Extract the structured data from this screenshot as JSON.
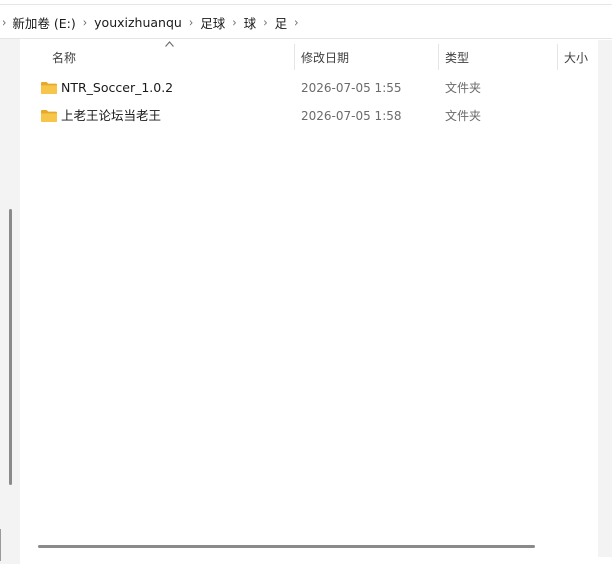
{
  "address_bar": {
    "crumbs": [
      "新加卷 (E:)",
      "youxizhuanqu",
      "足球",
      "球",
      "足"
    ]
  },
  "columns": {
    "name": "名称",
    "date_modified": "修改日期",
    "type": "类型",
    "size": "大小"
  },
  "files": [
    {
      "name": "NTR_Soccer_1.0.2",
      "date": "2026-07-05 1:55",
      "type": "文件夹",
      "icon": "folder-icon"
    },
    {
      "name": "上老王论坛当老王",
      "date": "2026-07-05 1:58",
      "type": "文件夹",
      "icon": "folder-icon"
    }
  ],
  "colors": {
    "folder": "#F8C54B",
    "folder_dark": "#E6A92A",
    "nav_bg": "#F3F3F3",
    "scrollbar": "#8A8A8A"
  }
}
